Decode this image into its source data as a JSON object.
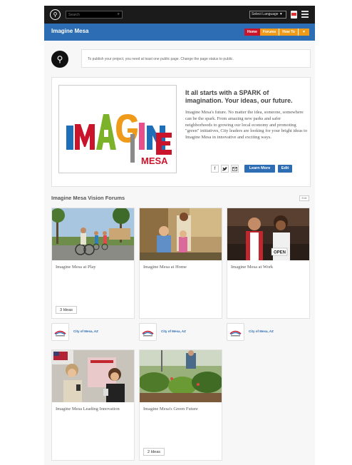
{
  "topbar": {
    "search_placeholder": "Search",
    "language_select": "Select Language ▼"
  },
  "header": {
    "title": "Imagine Mesa",
    "nav": [
      "Home",
      "Forums",
      "How To",
      "▼"
    ]
  },
  "notice": {
    "text": "To publish your project, you need at least one public page. Change the page status to public."
  },
  "feature": {
    "logo_letters": "IMAGINE",
    "logo_sub": "MESA",
    "title": "It all starts with a SPARK of imagination. Your ideas, our future.",
    "description": "Imagine Mesa's future. No matter the idea, someone, somewhere can be the spark. From amazing new parks and safer neighborhoods to growing our local economy and promoting \"green\" initiatives, City leaders are looking for your bright ideas to Imagine Mesa in innovative and exciting ways.",
    "share_icons": [
      "f",
      "🐦",
      "✉"
    ],
    "learn_more": "Learn More",
    "edit": "Edit"
  },
  "forums": {
    "title": "Imagine Mesa Vision Forums",
    "edit": "Edit",
    "cards": [
      {
        "name": "Imagine Mesa at Play",
        "ideas": "3 Ideas",
        "scene": "bike"
      },
      {
        "name": "Imagine Mesa at Home",
        "ideas": "",
        "scene": "home"
      },
      {
        "name": "Imagine Mesa at Work",
        "ideas": "",
        "scene": "work"
      },
      {
        "name": "Imagine Mesa Leading Innovation",
        "ideas": "",
        "scene": "innovation"
      },
      {
        "name": "Imagine Mesa's Green Future",
        "ideas": "2 Ideas",
        "scene": "garden"
      }
    ],
    "owners": [
      "City of Mesa, AZ",
      "City of Mesa, AZ",
      "City of Mesa, AZ"
    ]
  },
  "colors": {
    "accent_blue": "#2c6db4",
    "home_red": "#c9142b",
    "nav_orange": "#f09a1a",
    "topbar": "#1b1b1b"
  }
}
